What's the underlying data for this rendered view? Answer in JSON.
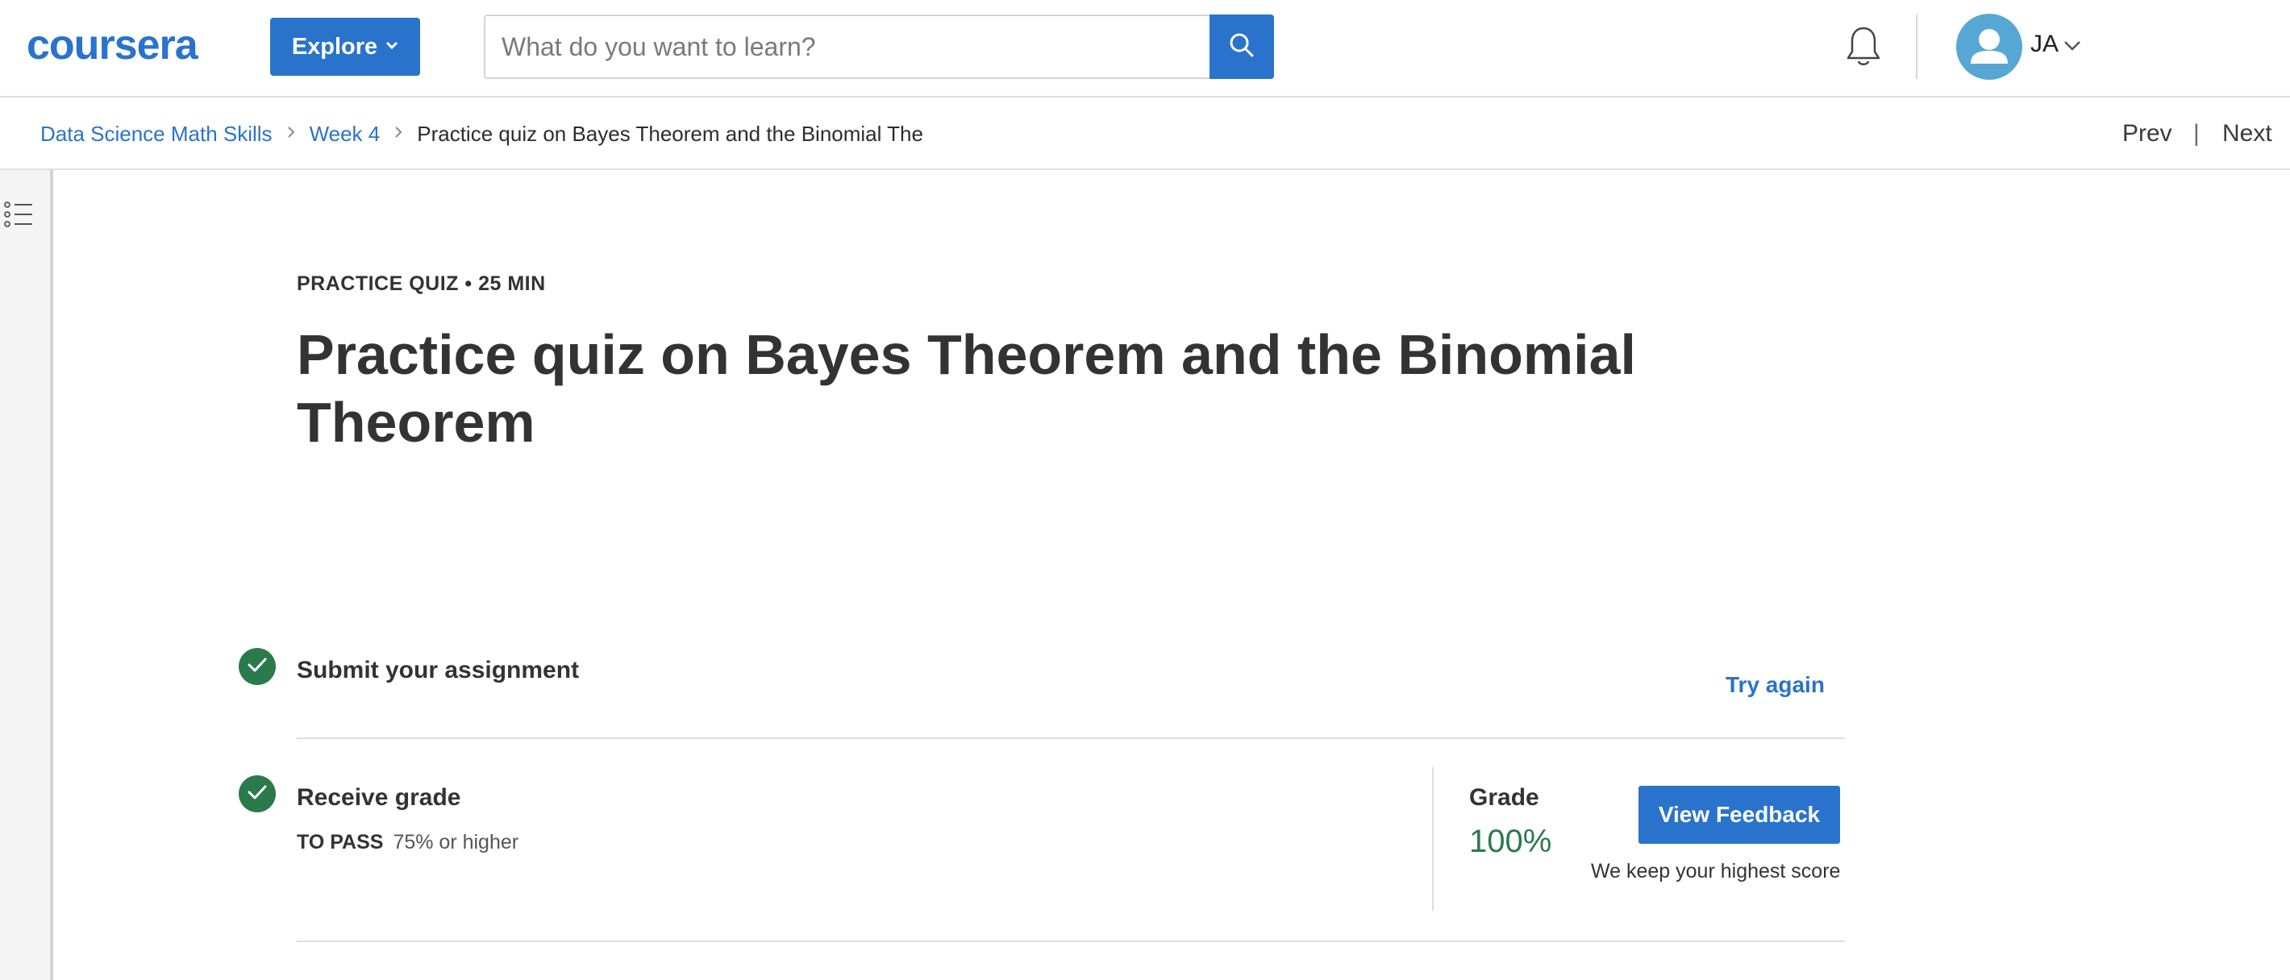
{
  "header": {
    "logo_text": "coursera",
    "explore_label": "Explore",
    "search_placeholder": "What do you want to learn?",
    "search_value": "",
    "user_initials": "JA"
  },
  "breadcrumb": {
    "items": [
      {
        "label": "Data Science Math Skills"
      },
      {
        "label": "Week 4"
      },
      {
        "label": "Practice quiz on Bayes Theorem and the Binomial The"
      }
    ],
    "prev_label": "Prev",
    "separator": "|",
    "next_label": "Next"
  },
  "quiz": {
    "meta": "PRACTICE QUIZ • 25 MIN",
    "title": "Practice quiz on Bayes Theorem and the Binomial Theorem",
    "submit_step": {
      "label": "Submit your assignment",
      "action_label": "Try again"
    },
    "grade_step": {
      "label": "Receive grade",
      "to_pass_label": "TO PASS",
      "to_pass_value": "75% or higher",
      "grade_label": "Grade",
      "grade_value": "100%",
      "feedback_button": "View Feedback",
      "note": "We keep your highest score"
    }
  },
  "colors": {
    "brand": "#2a73cc",
    "success": "#2b7a4b",
    "avatar": "#56a7d4"
  },
  "icons": {
    "search": "search-icon",
    "bell": "bell-icon",
    "avatar": "user-avatar-icon",
    "chevron": "chevron-down-icon",
    "outline": "outline-list-icon",
    "check": "check-icon"
  }
}
